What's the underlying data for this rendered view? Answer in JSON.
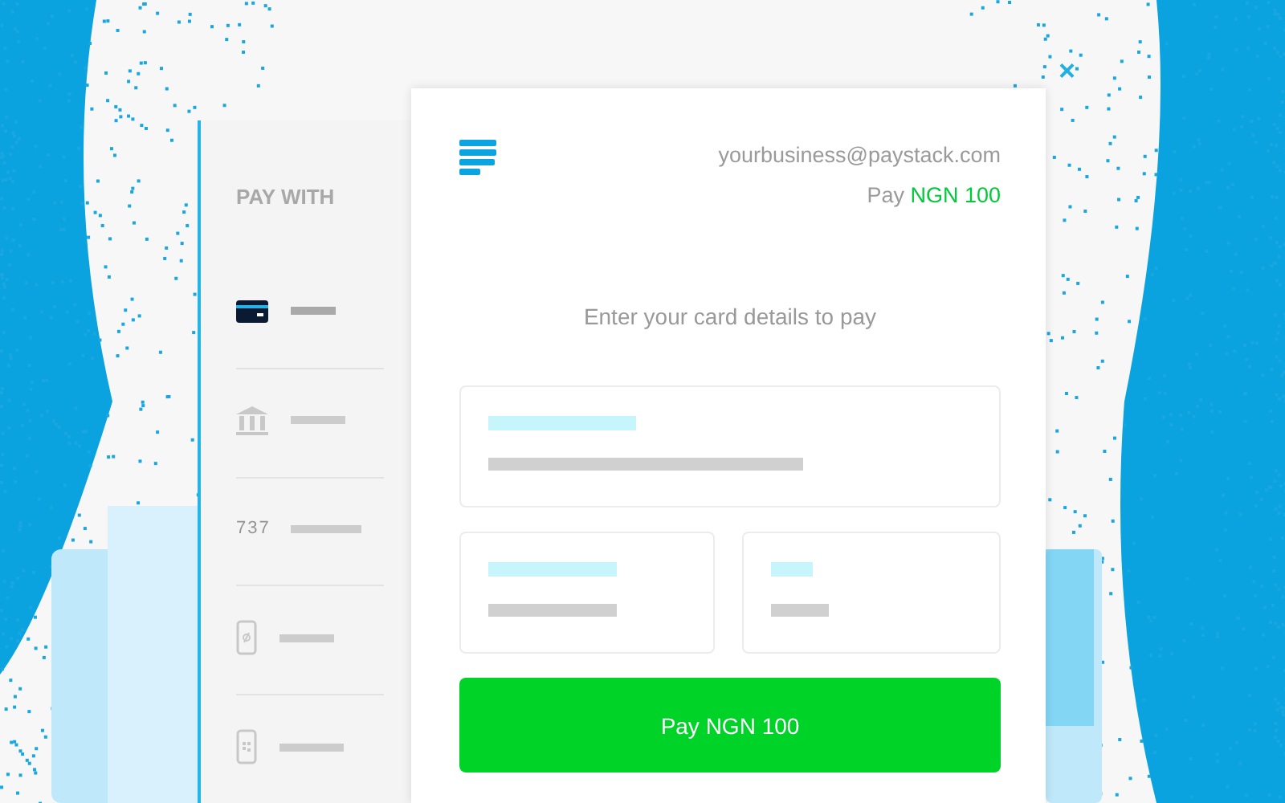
{
  "sidebar": {
    "title": "PAY WITH",
    "methods": [
      {
        "kind": "card",
        "selected": true
      },
      {
        "kind": "bank",
        "selected": false
      },
      {
        "kind": "ussd",
        "code": "737",
        "selected": false
      },
      {
        "kind": "phone",
        "selected": false
      },
      {
        "kind": "qr",
        "selected": false
      }
    ]
  },
  "header": {
    "email": "yourbusiness@paystack.com",
    "pay_label": "Pay",
    "amount": "NGN 100"
  },
  "prompt": "Enter your card details to pay",
  "button": "Pay NGN 100",
  "close": "×"
}
